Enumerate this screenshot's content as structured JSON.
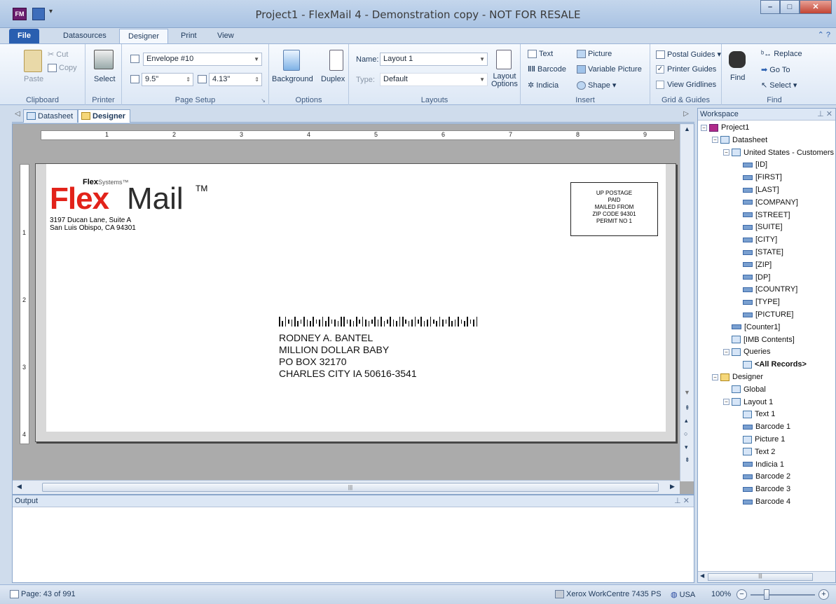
{
  "window": {
    "title": "Project1 - FlexMail 4 - Demonstration copy - NOT FOR RESALE",
    "app_icon": "FM",
    "controls": [
      "minimize",
      "maximize",
      "close"
    ]
  },
  "tabs": [
    "File",
    "Datasources",
    "Designer",
    "Print",
    "View"
  ],
  "active_tab": "Designer",
  "ribbon": {
    "clipboard": {
      "paste": "Paste",
      "cut": "Cut",
      "copy": "Copy",
      "label": "Clipboard"
    },
    "printer": {
      "select": "Select",
      "label": "Printer"
    },
    "page_setup": {
      "envelope": "Envelope #10",
      "width": "9.5\"",
      "height": "4.13\"",
      "label": "Page Setup"
    },
    "options": {
      "background": "Background",
      "duplex": "Duplex",
      "label": "Options"
    },
    "layouts": {
      "name_label": "Name:",
      "name_value": "Layout 1",
      "type_label": "Type:",
      "type_value": "Default",
      "layout_options_1": "Layout",
      "layout_options_2": "Options",
      "label": "Layouts"
    },
    "insert": {
      "text": "Text",
      "picture": "Picture",
      "barcode": "Barcode",
      "variable_picture": "Variable Picture",
      "indicia": "Indicia",
      "shape": "Shape",
      "label": "Insert"
    },
    "grid_guides": {
      "postal_guides": "Postal Guides",
      "printer_guides": "Printer Guides",
      "view_gridlines": "View Gridlines",
      "label": "Grid & Guides"
    },
    "find": {
      "find": "Find",
      "replace": "Replace",
      "goto": "Go To",
      "select": "Select",
      "label": "Find"
    }
  },
  "doc_tabs": [
    "Datasheet",
    "Designer"
  ],
  "ruler_numbers": [
    "1",
    "2",
    "3",
    "4",
    "5",
    "6",
    "7",
    "8",
    "9"
  ],
  "ruler_v_numbers": [
    "1",
    "2",
    "3",
    "4"
  ],
  "envelope": {
    "logo_small": "Flex",
    "logo_small_suffix": "Systems™",
    "logo_flex": "Flex",
    "logo_mail": "Mail",
    "logo_tm": "TM",
    "return_address": [
      "3197 Ducan Lane, Suite A",
      "San Luis Obispo, CA 94301"
    ],
    "postage": [
      "UP POSTAGE",
      "PAID",
      "MAILED FROM",
      "ZIP CODE 94301",
      "PERMIT NO 1"
    ],
    "recipient": [
      "RODNEY A. BANTEL",
      "MILLION DOLLAR BABY",
      "PO BOX 32170",
      "CHARLES CITY IA 50616-3541"
    ]
  },
  "output": {
    "title": "Output"
  },
  "workspace": {
    "title": "Workspace",
    "tree": [
      {
        "label": "Project1",
        "level": 0,
        "icon": "project-icon",
        "exp": "−"
      },
      {
        "label": "Datasheet",
        "level": 1,
        "icon": "datasheet-icon",
        "exp": "−"
      },
      {
        "label": "United States - Customers",
        "level": 2,
        "icon": "table-icon",
        "exp": "−"
      },
      {
        "label": "[ID]",
        "level": 3,
        "icon": "field-icon"
      },
      {
        "label": "[FIRST]",
        "level": 3,
        "icon": "field-icon"
      },
      {
        "label": "[LAST]",
        "level": 3,
        "icon": "field-icon"
      },
      {
        "label": "[COMPANY]",
        "level": 3,
        "icon": "field-icon"
      },
      {
        "label": "[STREET]",
        "level": 3,
        "icon": "field-icon"
      },
      {
        "label": "[SUITE]",
        "level": 3,
        "icon": "field-icon"
      },
      {
        "label": "[CITY]",
        "level": 3,
        "icon": "field-icon"
      },
      {
        "label": "[STATE]",
        "level": 3,
        "icon": "field-icon"
      },
      {
        "label": "[ZIP]",
        "level": 3,
        "icon": "field-icon"
      },
      {
        "label": "[DP]",
        "level": 3,
        "icon": "field-icon"
      },
      {
        "label": "[COUNTRY]",
        "level": 3,
        "icon": "field-icon"
      },
      {
        "label": "[TYPE]",
        "level": 3,
        "icon": "field-icon"
      },
      {
        "label": "[PICTURE]",
        "level": 3,
        "icon": "field-icon"
      },
      {
        "label": "[Counter1]",
        "level": 2,
        "icon": "counter-icon"
      },
      {
        "label": "[IMB Contents]",
        "level": 2,
        "icon": "imb-icon"
      },
      {
        "label": "Queries",
        "level": 2,
        "icon": "queries-icon",
        "exp": "−"
      },
      {
        "label": "<All Records>",
        "level": 3,
        "icon": "query-icon",
        "bold": true
      },
      {
        "label": "Designer",
        "level": 1,
        "icon": "designer-icon",
        "exp": "−"
      },
      {
        "label": "Global",
        "level": 2,
        "icon": "page-icon"
      },
      {
        "label": "Layout 1",
        "level": 2,
        "icon": "page-icon",
        "exp": "−"
      },
      {
        "label": "Text 1",
        "level": 3,
        "icon": "text-icon"
      },
      {
        "label": "Barcode 1",
        "level": 3,
        "icon": "barcode-icon"
      },
      {
        "label": "Picture 1",
        "level": 3,
        "icon": "picture-icon"
      },
      {
        "label": "Text 2",
        "level": 3,
        "icon": "text-icon"
      },
      {
        "label": "Indicia 1",
        "level": 3,
        "icon": "indicia-icon"
      },
      {
        "label": "Barcode 2",
        "level": 3,
        "icon": "barcode-icon"
      },
      {
        "label": "Barcode 3",
        "level": 3,
        "icon": "barcode-icon"
      },
      {
        "label": "Barcode 4",
        "level": 3,
        "icon": "barcode-icon"
      }
    ]
  },
  "statusbar": {
    "page": "Page: 43 of 991",
    "printer": "Xerox WorkCentre 7435 PS",
    "locale": "USA",
    "zoom": "100%",
    "zoom_level_fraction": 0.25
  },
  "colors": {
    "brand_red": "#e2231a",
    "ribbon_blue": "#2a5fb0"
  }
}
